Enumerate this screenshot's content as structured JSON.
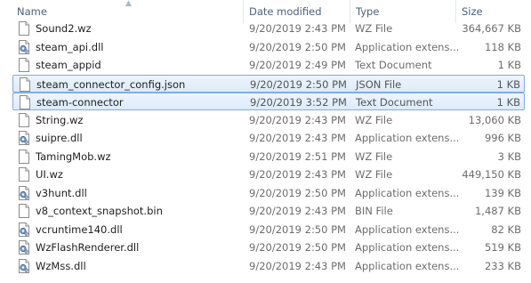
{
  "columns": {
    "name": "Name",
    "date_modified": "Date modified",
    "type": "Type",
    "size": "Size"
  },
  "files": [
    {
      "name": "Sound2.wz",
      "date": "9/20/2019 2:43 PM",
      "type": "WZ File",
      "size": "364,667 KB",
      "icon": "file-icon",
      "selected": false
    },
    {
      "name": "steam_api.dll",
      "date": "9/20/2019 2:50 PM",
      "type": "Application extens...",
      "size": "118 KB",
      "icon": "dll-icon",
      "selected": false
    },
    {
      "name": "steam_appid",
      "date": "9/20/2019 2:49 PM",
      "type": "Text Document",
      "size": "1 KB",
      "icon": "file-icon",
      "selected": false
    },
    {
      "name": "steam_connector_config.json",
      "date": "9/20/2019 2:50 PM",
      "type": "JSON File",
      "size": "1 KB",
      "icon": "file-icon",
      "selected": true
    },
    {
      "name": "steam-connector",
      "date": "9/20/2019 3:52 PM",
      "type": "Text Document",
      "size": "1 KB",
      "icon": "file-icon",
      "selected": true
    },
    {
      "name": "String.wz",
      "date": "9/20/2019 2:43 PM",
      "type": "WZ File",
      "size": "13,060 KB",
      "icon": "file-icon",
      "selected": false
    },
    {
      "name": "suipre.dll",
      "date": "9/20/2019 2:43 PM",
      "type": "Application extens...",
      "size": "996 KB",
      "icon": "dll-icon",
      "selected": false
    },
    {
      "name": "TamingMob.wz",
      "date": "9/20/2019 2:51 PM",
      "type": "WZ File",
      "size": "3 KB",
      "icon": "file-icon",
      "selected": false
    },
    {
      "name": "UI.wz",
      "date": "9/20/2019 2:43 PM",
      "type": "WZ File",
      "size": "449,150 KB",
      "icon": "file-icon",
      "selected": false
    },
    {
      "name": "v3hunt.dll",
      "date": "9/20/2019 2:50 PM",
      "type": "Application extens...",
      "size": "139 KB",
      "icon": "dll-icon",
      "selected": false
    },
    {
      "name": "v8_context_snapshot.bin",
      "date": "9/20/2019 2:43 PM",
      "type": "BIN File",
      "size": "1,487 KB",
      "icon": "file-icon",
      "selected": false
    },
    {
      "name": "vcruntime140.dll",
      "date": "9/20/2019 2:50 PM",
      "type": "Application extens...",
      "size": "82 KB",
      "icon": "dll-icon",
      "selected": false
    },
    {
      "name": "WzFlashRenderer.dll",
      "date": "9/20/2019 2:50 PM",
      "type": "Application extens...",
      "size": "519 KB",
      "icon": "dll-icon",
      "selected": false
    },
    {
      "name": "WzMss.dll",
      "date": "9/20/2019 2:43 PM",
      "type": "Application extens...",
      "size": "233 KB",
      "icon": "dll-icon",
      "selected": false
    }
  ],
  "colors": {
    "selection_border": "#84acdd",
    "header_text": "#4c607a"
  }
}
